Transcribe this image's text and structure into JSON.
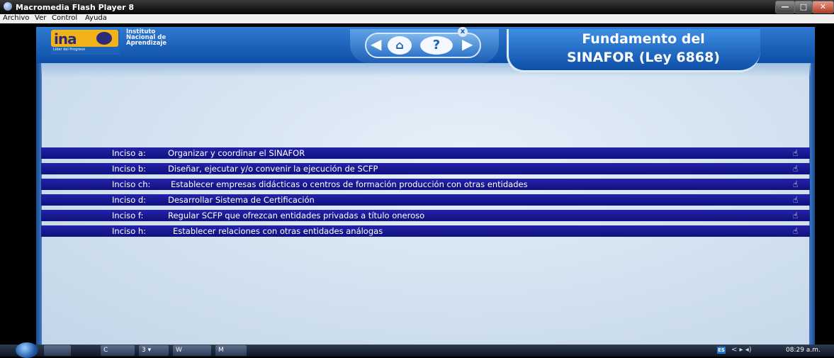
{
  "window": {
    "title": "Macromedia Flash Player 8",
    "controls": {
      "minimize": "—",
      "maximize": "□",
      "close": "✕"
    }
  },
  "menu": [
    "Archivo",
    "Ver",
    "Control",
    "Ayuda"
  ],
  "header": {
    "logo_text": "ina",
    "logo_tagline": "Líder del Progreso",
    "institute_lines": [
      "Instituto",
      "Nacional de",
      "Aprendizaje"
    ],
    "title_line1": "Fundamento del",
    "title_line2": "SINAFOR (Ley 6868)"
  },
  "nav": {
    "prev": "◀",
    "home": "⌂",
    "help": "?",
    "next": "▶",
    "close": "x"
  },
  "rows": [
    {
      "label": "Inciso a:",
      "text": "Organizar y coordinar el SINAFOR"
    },
    {
      "label": "Inciso b:",
      "text": "Diseñar, ejecutar y/o convenir la ejecución de SCFP"
    },
    {
      "label": "Inciso ch:",
      "text": "Establecer empresas didácticas o centros de formación producción con otras entidades"
    },
    {
      "label": "Inciso d:",
      "text": "Desarrollar Sistema de Certificación"
    },
    {
      "label": "Inciso f:",
      "text": "Regular SCFP que ofrezcan entidades privadas a título oneroso"
    },
    {
      "label": "Inciso h:",
      "text": "Establecer relaciones con otras entidades análogas"
    }
  ],
  "row_icon": "hand-pointer-icon",
  "taskbar": {
    "items": [
      "C",
      "3 ▾",
      "W",
      "M"
    ],
    "tray_lang": "ES",
    "time": "08:29 a.m."
  },
  "colors": {
    "row": "#14148c",
    "header": "#1d5eb5",
    "content": "#d1e1ef"
  }
}
